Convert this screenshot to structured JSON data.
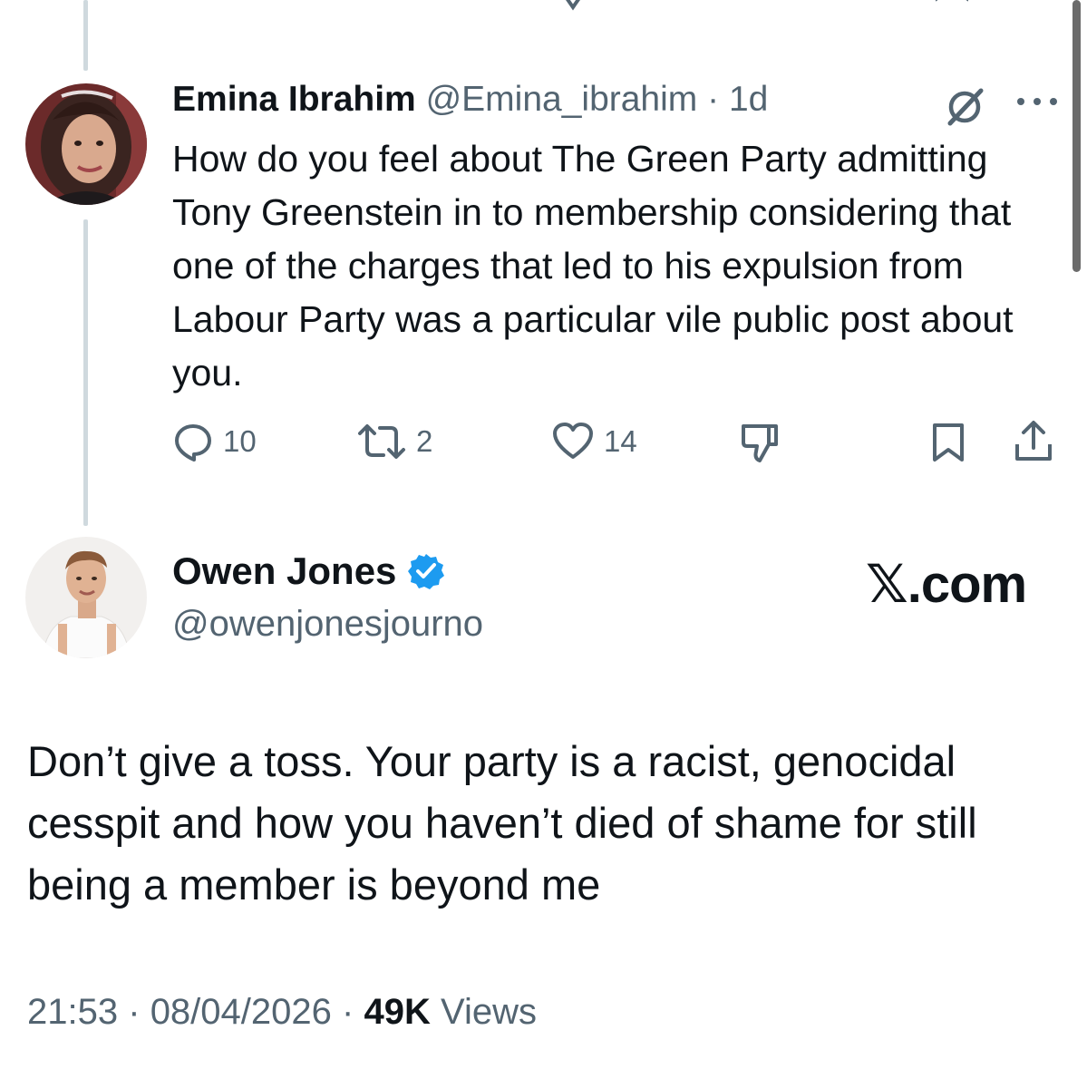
{
  "reply": {
    "author_name": "Emina Ibrahim",
    "author_handle": "@Emina_ibrahim",
    "separator": "·",
    "age": "1d",
    "text": "How do you feel about The Green Party admitting Tony Greenstein in to membership considering that one of the charges that led to his expulsion from Labour Party was a particular vile public post about you.",
    "stats": {
      "replies": "10",
      "reposts": "2",
      "likes": "14"
    }
  },
  "main_post": {
    "author_name": "Owen Jones",
    "author_handle": "@owenjonesjourno",
    "verified": true,
    "brand": "𝕏.com",
    "text": "Don’t give a toss. Your party is a racist, genocidal cesspit and how you haven’t died of shame for still being a member is beyond me",
    "time": "21:53",
    "date": "08/04/2026",
    "separator": "·",
    "views_count": "49K",
    "views_label": "Views"
  },
  "icons": {
    "reply": "speech-bubble-icon",
    "repost": "repost-arrows-icon",
    "like": "heart-icon",
    "dislike": "thumbs-down-icon",
    "bookmark": "bookmark-icon",
    "share": "share-icon",
    "grok": "grok-icon",
    "more": "more-dots-icon",
    "verified": "verified-badge-icon"
  },
  "colors": {
    "text": "#0f1419",
    "muted": "#536471",
    "verified_blue": "#1d9bf0",
    "thread_line": "#cfd9de"
  }
}
